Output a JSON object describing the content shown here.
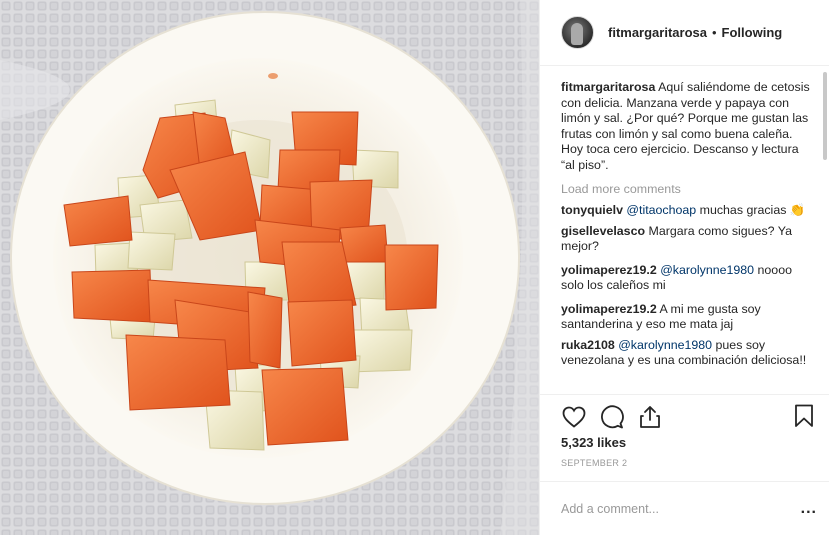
{
  "header": {
    "username": "fitmargaritarosa",
    "separator": "•",
    "follow_status": "Following"
  },
  "photo": {
    "subject": "white bowl with papaya and green apple pieces on white towel"
  },
  "caption": {
    "username": "fitmargaritarosa",
    "text": "Aquí saliéndome de cetosis con delicia. Manzana verde y papaya con limón y sal. ¿Por qué? Porque me gustan las frutas con limón y sal como buena caleña. Hoy toca cero ejercicio. Descanso y lectura “al piso”."
  },
  "load_more_label": "Load more comments",
  "comments": [
    {
      "username": "tonyquielv",
      "mention": "@titaochoap",
      "text": " muchas gracias 👏"
    },
    {
      "username": "gisellevelasco",
      "mention": "",
      "text": "Margara como sigues? Ya mejor?"
    },
    {
      "username": "yolimaperez19.2",
      "mention": "@karolynne1980",
      "text": " noooo solo los caleños mi"
    },
    {
      "username": "yolimaperez19.2",
      "mention": "",
      "text": "A mi me gusta soy santanderina y eso me mata jaj"
    },
    {
      "username": "ruka2108",
      "mention": "@karolynne1980",
      "text": " pues soy venezolana y es una combinación deliciosa!!"
    }
  ],
  "actions": {
    "like_icon": "heart-icon",
    "comment_icon": "comment-bubble-icon",
    "share_icon": "share-upload-icon",
    "save_icon": "bookmark-icon"
  },
  "likes": "5,323 likes",
  "date": "SEPTEMBER 2",
  "add_comment": {
    "placeholder": "Add a comment...",
    "more_label": "..."
  },
  "colors": {
    "mention": "#003569",
    "muted": "#999999",
    "papaya": "#f06a2c",
    "apple": "#f1ecc9",
    "bowl": "#f7f3ea"
  }
}
